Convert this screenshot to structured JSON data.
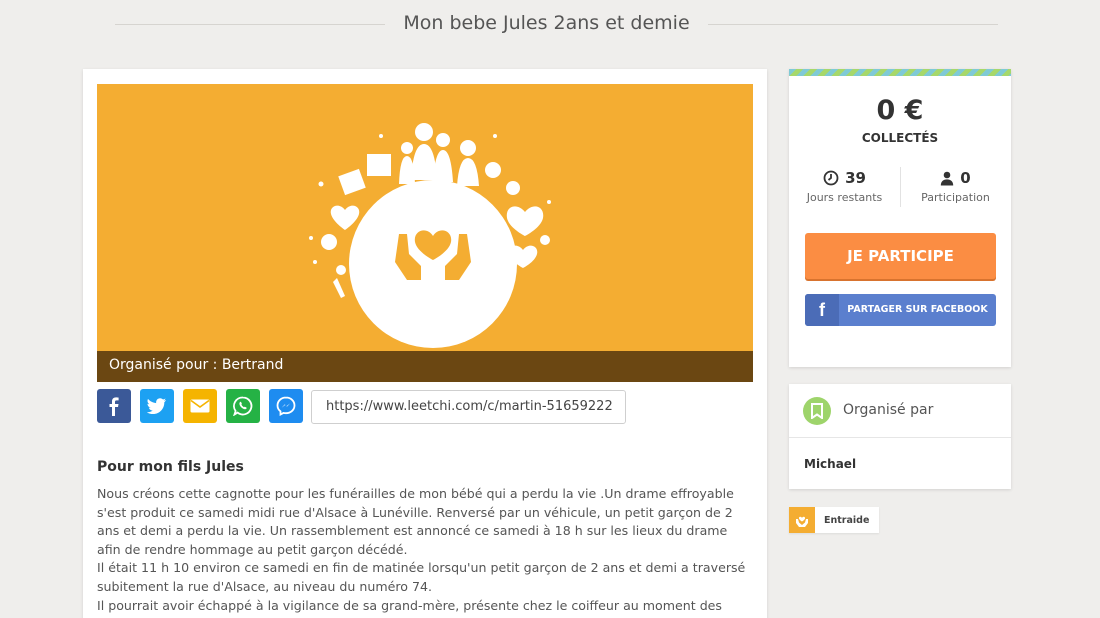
{
  "page": {
    "title": "Mon bebe Jules 2ans et demie"
  },
  "hero": {
    "caption": "Organisé pour : Bertrand",
    "background": "#f4ad32"
  },
  "share": {
    "buttons": [
      {
        "icon": "facebook-icon",
        "color": "#3b5998"
      },
      {
        "icon": "twitter-icon",
        "color": "#1da1f2"
      },
      {
        "icon": "email-icon",
        "color": "#f5b400"
      },
      {
        "icon": "whatsapp-icon",
        "color": "#25b245"
      },
      {
        "icon": "messenger-icon",
        "color": "#1e8cf0"
      }
    ],
    "url": "https://www.leetchi.com/c/martin-51659222"
  },
  "content": {
    "heading": "Pour mon fils Jules",
    "lines": [
      "Nous créons cette cagnotte pour les funérailles de mon bébé qui a perdu la vie .Un drame effroyable s'est produit ce samedi midi rue d'Alsace à Lunéville. Renversé par un véhicule, un petit garçon de 2 ans et demi a perdu la vie. Un rassemblement est annoncé ce samedi à 18 h sur les lieux du drame afin de rendre hommage au petit garçon décédé.",
      "Il était 11 h 10 environ ce samedi en fin de matinée lorsqu'un petit garçon de 2 ans et demi a traversé subitement la rue d'Alsace, au niveau du numéro 74.",
      "Il pourrait avoir échappé à la vigilance de sa grand-mère, présente chez le coiffeur au moment des"
    ]
  },
  "sidebar": {
    "amount": "0 €",
    "collected_label": "COLLECTÉS",
    "days_value": "39",
    "days_label": "Jours restants",
    "participants_value": "0",
    "participants_label": "Participation",
    "participate_button": "JE PARTICIPE",
    "facebook_button": "PARTAGER SUR FACEBOOK",
    "facebook_letter": "f",
    "accent": "#fb8d43"
  },
  "organizer": {
    "title": "Organisé par",
    "name": "Michael"
  },
  "category": {
    "label": "Entraide"
  }
}
